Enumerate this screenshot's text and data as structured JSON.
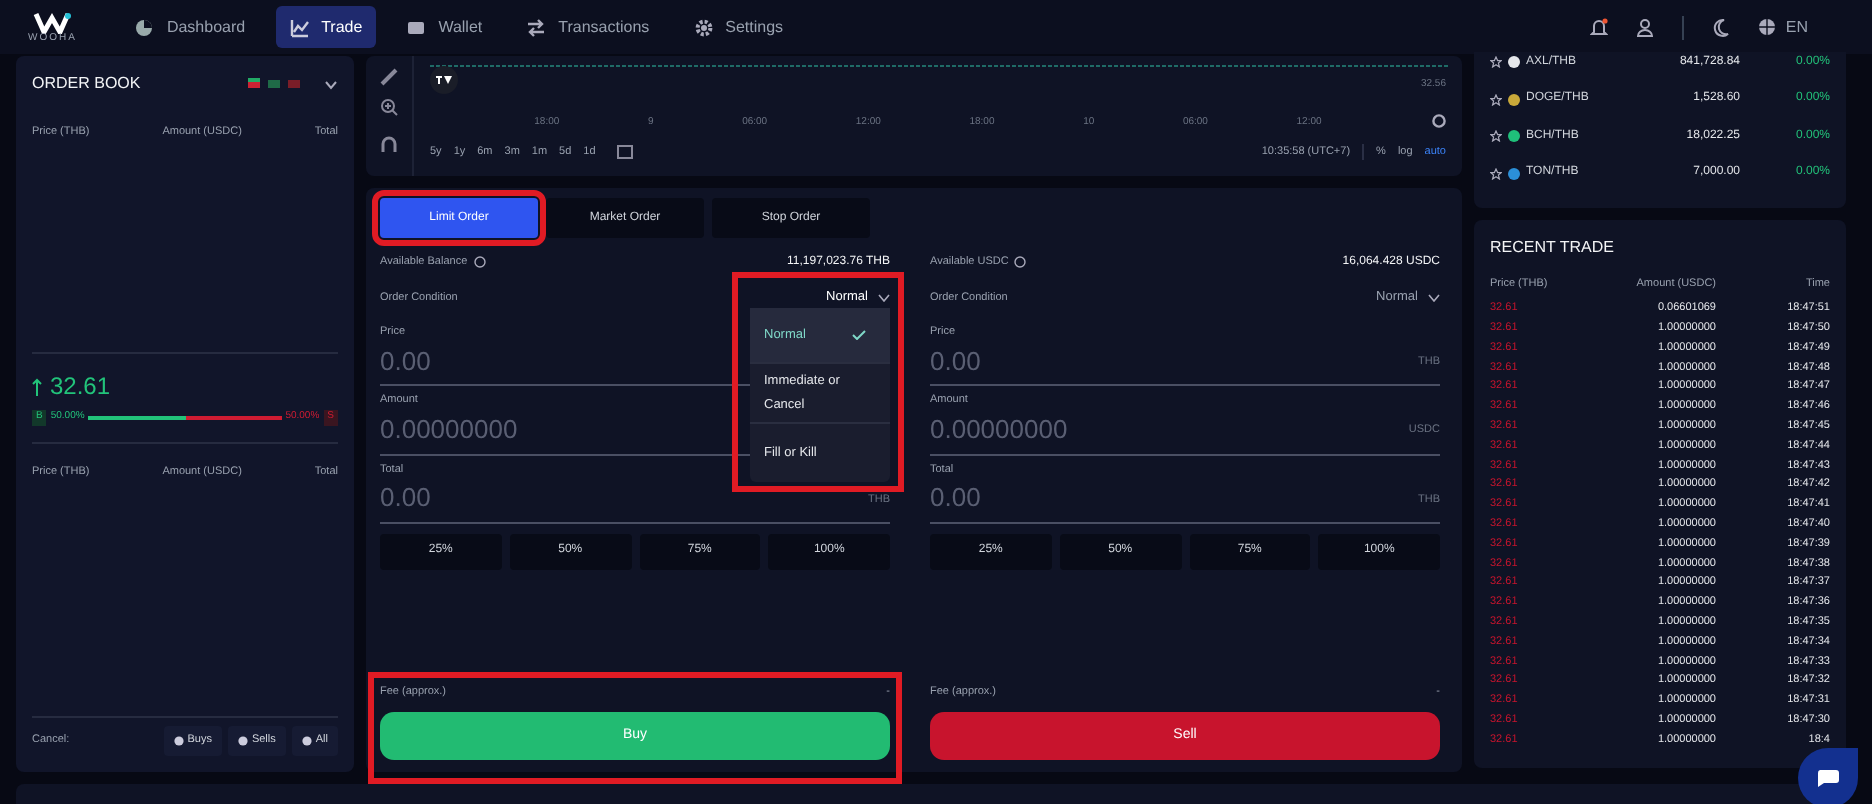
{
  "nav": {
    "logo_text": "WOOHA",
    "items": [
      {
        "label": "Dashboard",
        "selected": false
      },
      {
        "label": "Trade",
        "selected": true
      },
      {
        "label": "Wallet",
        "selected": false
      },
      {
        "label": "Transactions",
        "selected": false
      },
      {
        "label": "Settings",
        "selected": false
      }
    ],
    "language": "EN"
  },
  "order_book": {
    "title": "ORDER BOOK",
    "columns": [
      "Price (THB)",
      "Amount (USDC)",
      "Total"
    ],
    "last_price": "32.61",
    "buy_label": "B",
    "buy_pct": "50.00%",
    "sell_pct": "50.00%",
    "sell_label": "S",
    "level": 0.5,
    "lower_columns": [
      "Price (THB)",
      "Amount (USDC)",
      "Total"
    ],
    "cancel_label": "Cancel:",
    "cancel_buttons": [
      "Buys",
      "Sells",
      "All"
    ]
  },
  "chart": {
    "x_labels": [
      "18:00",
      "9",
      "06:00",
      "12:00",
      "18:00",
      "10",
      "06:00",
      "12:00"
    ],
    "price_label": "32.56",
    "timeframes": [
      "5y",
      "1y",
      "6m",
      "3m",
      "1m",
      "5d",
      "1d"
    ],
    "clock": "10:35:58 (UTC+7)",
    "options": [
      {
        "label": "%",
        "selected": false
      },
      {
        "label": "log",
        "selected": false
      },
      {
        "label": "auto",
        "selected": true
      }
    ]
  },
  "order_tabs": [
    {
      "label": "Limit Order",
      "selected": true
    },
    {
      "label": "Market Order",
      "selected": false
    },
    {
      "label": "Stop Order",
      "selected": false
    }
  ],
  "forms": [
    {
      "kind": "buy",
      "balance_label": "Available Balance",
      "balance": "11,197,023.76 THB",
      "condition_label": "Order Condition",
      "condition": "Normal",
      "dropdown_open": true,
      "fields": [
        {
          "label": "Price",
          "placeholder": "0.00"
        },
        {
          "label": "Amount",
          "placeholder": "0.00000000"
        },
        {
          "label": "Total",
          "placeholder": "0.00",
          "unit": "THB"
        }
      ],
      "percents": [
        "25%",
        "50%",
        "75%",
        "100%"
      ],
      "fee_label": "Fee (approx.)",
      "fee": "-",
      "action": "Buy"
    },
    {
      "kind": "sell",
      "balance_label": "Available USDC",
      "balance": "16,064.428 USDC",
      "condition_label": "Order Condition",
      "condition": "Normal",
      "dropdown_open": false,
      "fields": [
        {
          "label": "Price",
          "placeholder": "0.00",
          "unit": "THB"
        },
        {
          "label": "Amount",
          "placeholder": "0.00000000",
          "unit": "USDC"
        },
        {
          "label": "Total",
          "placeholder": "0.00",
          "unit": "THB"
        }
      ],
      "percents": [
        "25%",
        "50%",
        "75%",
        "100%"
      ],
      "fee_label": "Fee (approx.)",
      "fee": "-",
      "action": "Sell"
    }
  ],
  "condition_menu": [
    {
      "label": "Normal",
      "selected": true
    },
    {
      "label": "Immediate or Cancel",
      "selected": false
    },
    {
      "label": "Fill or Kill",
      "selected": false
    }
  ],
  "markets": [
    {
      "pair": "AXL/THB",
      "price": "841,728.84",
      "change": "0.00%",
      "color": "#e5e7eb"
    },
    {
      "pair": "DOGE/THB",
      "price": "1,528.60",
      "change": "0.00%",
      "color": "#c9a93a"
    },
    {
      "pair": "BCH/THB",
      "price": "18,022.25",
      "change": "0.00%",
      "color": "#1fbf7a"
    },
    {
      "pair": "TON/THB",
      "price": "7,000.00",
      "change": "0.00%",
      "color": "#2b8fd8"
    }
  ],
  "recent_trade": {
    "title": "RECENT TRADE",
    "columns": [
      "Price (THB)",
      "Amount (USDC)",
      "Time"
    ],
    "rows": [
      [
        "32.61",
        "0.06601069",
        "18:47:51"
      ],
      [
        "32.61",
        "1.00000000",
        "18:47:50"
      ],
      [
        "32.61",
        "1.00000000",
        "18:47:49"
      ],
      [
        "32.61",
        "1.00000000",
        "18:47:48"
      ],
      [
        "32.61",
        "1.00000000",
        "18:47:47"
      ],
      [
        "32.61",
        "1.00000000",
        "18:47:46"
      ],
      [
        "32.61",
        "1.00000000",
        "18:47:45"
      ],
      [
        "32.61",
        "1.00000000",
        "18:47:44"
      ],
      [
        "32.61",
        "1.00000000",
        "18:47:43"
      ],
      [
        "32.61",
        "1.00000000",
        "18:47:42"
      ],
      [
        "32.61",
        "1.00000000",
        "18:47:41"
      ],
      [
        "32.61",
        "1.00000000",
        "18:47:40"
      ],
      [
        "32.61",
        "1.00000000",
        "18:47:39"
      ],
      [
        "32.61",
        "1.00000000",
        "18:47:38"
      ],
      [
        "32.61",
        "1.00000000",
        "18:47:37"
      ],
      [
        "32.61",
        "1.00000000",
        "18:47:36"
      ],
      [
        "32.61",
        "1.00000000",
        "18:47:35"
      ],
      [
        "32.61",
        "1.00000000",
        "18:47:34"
      ],
      [
        "32.61",
        "1.00000000",
        "18:47:33"
      ],
      [
        "32.61",
        "1.00000000",
        "18:47:32"
      ],
      [
        "32.61",
        "1.00000000",
        "18:47:31"
      ],
      [
        "32.61",
        "1.00000000",
        "18:47:30"
      ],
      [
        "32.61",
        "1.00000000",
        "18:4"
      ]
    ]
  }
}
